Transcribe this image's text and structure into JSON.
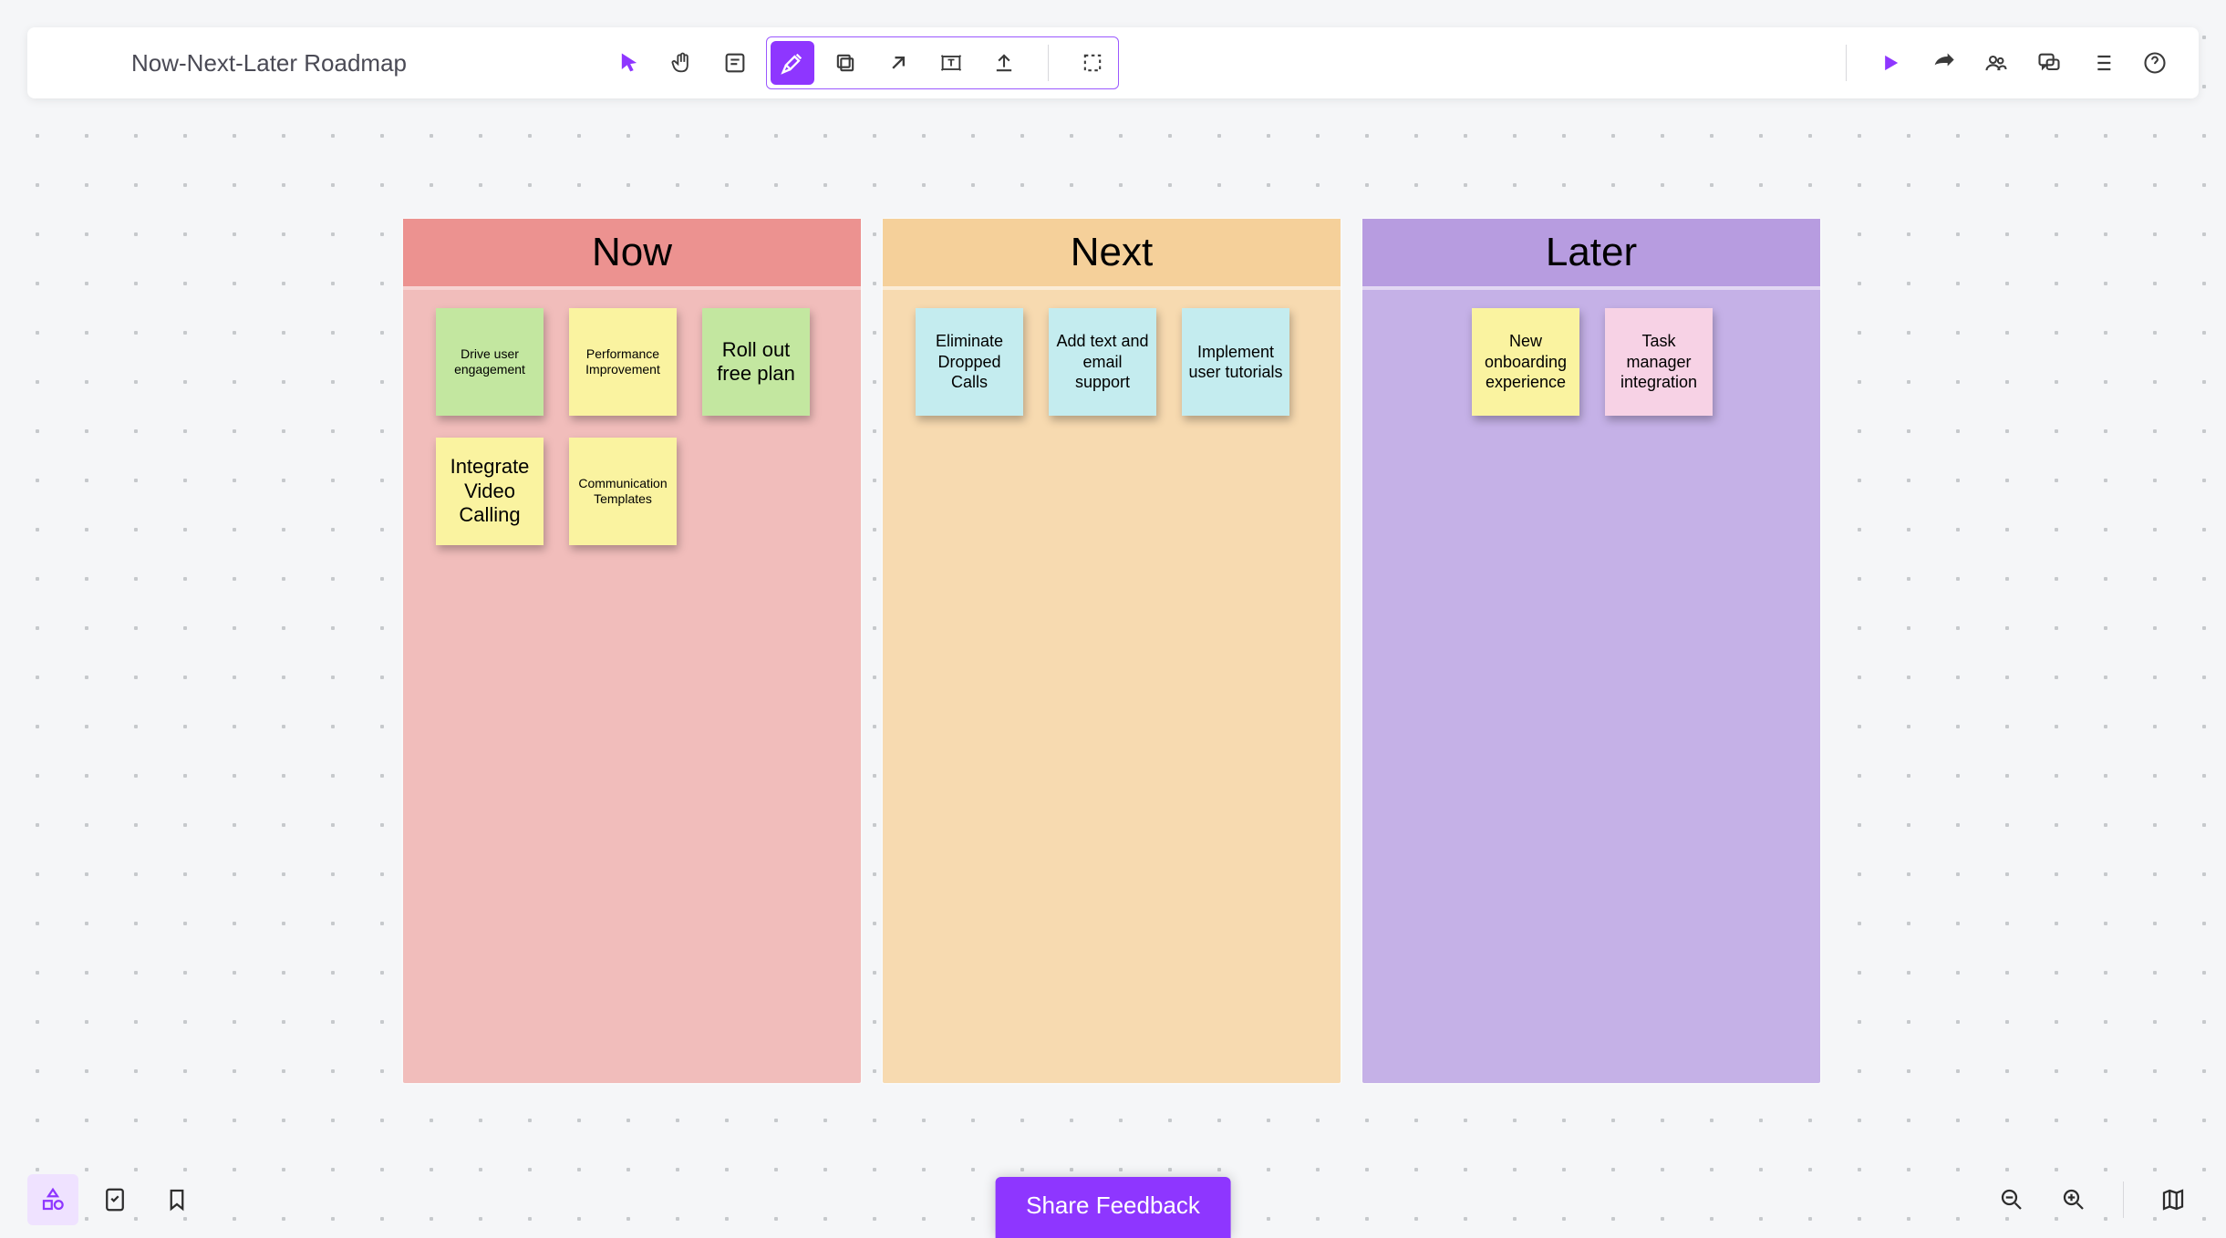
{
  "doc": {
    "title": "Now-Next-Later Roadmap"
  },
  "toolbar": {
    "tools": {
      "select": "Select",
      "pan": "Pan",
      "note": "Note",
      "build": "Build tools",
      "duplicate": "Duplicate",
      "link": "Open link",
      "text_box": "Text box",
      "upload": "Upload",
      "marquee": "Marquee select"
    },
    "right": {
      "present": "Present",
      "share": "Share",
      "collaborators": "Collaborators",
      "comments": "Comments",
      "outline": "Outline",
      "help": "Help"
    }
  },
  "columns": [
    {
      "id": "now",
      "title": "Now",
      "cards": [
        {
          "text": "Drive user engagement",
          "color": "green",
          "size": "small-text"
        },
        {
          "text": "Performance Improvement",
          "color": "yellow",
          "size": "small-text"
        },
        {
          "text": "Roll out free plan",
          "color": "green",
          "size": "big-text"
        },
        {
          "text": "Integrate Video Calling",
          "color": "yellow",
          "size": "big-text"
        },
        {
          "text": "Communication Templates",
          "color": "yellow",
          "size": "small-text"
        }
      ]
    },
    {
      "id": "next",
      "title": "Next",
      "cards": [
        {
          "text": "Eliminate Dropped Calls",
          "color": "blue",
          "size": "mid-text"
        },
        {
          "text": "Add text and email support",
          "color": "blue",
          "size": "mid-text"
        },
        {
          "text": "Implement user tutorials",
          "color": "blue",
          "size": "mid-text"
        }
      ]
    },
    {
      "id": "later",
      "title": "Later",
      "cards": [
        {
          "text": "New onboarding experience",
          "color": "yellow",
          "size": "mid-text"
        },
        {
          "text": "Task manager integration",
          "color": "pink",
          "size": "mid-text"
        }
      ]
    }
  ],
  "bottom": {
    "shapes": "Shapes panel",
    "tasks": "Task checklist",
    "bookmark": "Bookmarks",
    "zoom_out": "Zoom out",
    "zoom_in": "Zoom in",
    "minimap": "Minimap"
  },
  "feedback": {
    "label": "Share Feedback"
  }
}
